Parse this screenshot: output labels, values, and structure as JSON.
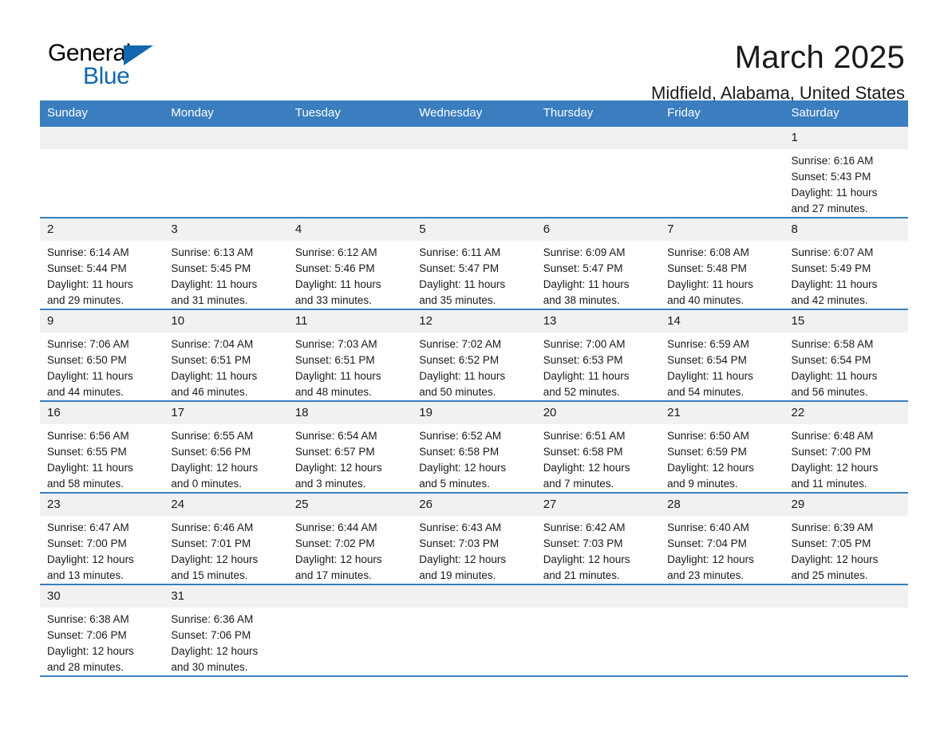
{
  "brand": {
    "name_top": "General",
    "name_bottom": "Blue",
    "accent_color": "#1267b0",
    "flag_icon": "triangle-flag-icon"
  },
  "header": {
    "title": "March 2025",
    "location": "Midfield, Alabama, United States"
  },
  "calendar": {
    "header_bg": "#3a7ebf",
    "row_rule_color": "#3a7ebf",
    "daynum_bg": "#f1f1f1",
    "weekdays": [
      "Sunday",
      "Monday",
      "Tuesday",
      "Wednesday",
      "Thursday",
      "Friday",
      "Saturday"
    ],
    "weeks": [
      [
        {
          "day": "",
          "sunrise": "",
          "sunset": "",
          "daylight_1": "",
          "daylight_2": "",
          "empty": true
        },
        {
          "day": "",
          "sunrise": "",
          "sunset": "",
          "daylight_1": "",
          "daylight_2": "",
          "empty": true
        },
        {
          "day": "",
          "sunrise": "",
          "sunset": "",
          "daylight_1": "",
          "daylight_2": "",
          "empty": true
        },
        {
          "day": "",
          "sunrise": "",
          "sunset": "",
          "daylight_1": "",
          "daylight_2": "",
          "empty": true
        },
        {
          "day": "",
          "sunrise": "",
          "sunset": "",
          "daylight_1": "",
          "daylight_2": "",
          "empty": true
        },
        {
          "day": "",
          "sunrise": "",
          "sunset": "",
          "daylight_1": "",
          "daylight_2": "",
          "empty": true
        },
        {
          "day": "1",
          "sunrise": "Sunrise: 6:16 AM",
          "sunset": "Sunset: 5:43 PM",
          "daylight_1": "Daylight: 11 hours",
          "daylight_2": "and 27 minutes.",
          "empty": false
        }
      ],
      [
        {
          "day": "2",
          "sunrise": "Sunrise: 6:14 AM",
          "sunset": "Sunset: 5:44 PM",
          "daylight_1": "Daylight: 11 hours",
          "daylight_2": "and 29 minutes.",
          "empty": false
        },
        {
          "day": "3",
          "sunrise": "Sunrise: 6:13 AM",
          "sunset": "Sunset: 5:45 PM",
          "daylight_1": "Daylight: 11 hours",
          "daylight_2": "and 31 minutes.",
          "empty": false
        },
        {
          "day": "4",
          "sunrise": "Sunrise: 6:12 AM",
          "sunset": "Sunset: 5:46 PM",
          "daylight_1": "Daylight: 11 hours",
          "daylight_2": "and 33 minutes.",
          "empty": false
        },
        {
          "day": "5",
          "sunrise": "Sunrise: 6:11 AM",
          "sunset": "Sunset: 5:47 PM",
          "daylight_1": "Daylight: 11 hours",
          "daylight_2": "and 35 minutes.",
          "empty": false
        },
        {
          "day": "6",
          "sunrise": "Sunrise: 6:09 AM",
          "sunset": "Sunset: 5:47 PM",
          "daylight_1": "Daylight: 11 hours",
          "daylight_2": "and 38 minutes.",
          "empty": false
        },
        {
          "day": "7",
          "sunrise": "Sunrise: 6:08 AM",
          "sunset": "Sunset: 5:48 PM",
          "daylight_1": "Daylight: 11 hours",
          "daylight_2": "and 40 minutes.",
          "empty": false
        },
        {
          "day": "8",
          "sunrise": "Sunrise: 6:07 AM",
          "sunset": "Sunset: 5:49 PM",
          "daylight_1": "Daylight: 11 hours",
          "daylight_2": "and 42 minutes.",
          "empty": false
        }
      ],
      [
        {
          "day": "9",
          "sunrise": "Sunrise: 7:06 AM",
          "sunset": "Sunset: 6:50 PM",
          "daylight_1": "Daylight: 11 hours",
          "daylight_2": "and 44 minutes.",
          "empty": false
        },
        {
          "day": "10",
          "sunrise": "Sunrise: 7:04 AM",
          "sunset": "Sunset: 6:51 PM",
          "daylight_1": "Daylight: 11 hours",
          "daylight_2": "and 46 minutes.",
          "empty": false
        },
        {
          "day": "11",
          "sunrise": "Sunrise: 7:03 AM",
          "sunset": "Sunset: 6:51 PM",
          "daylight_1": "Daylight: 11 hours",
          "daylight_2": "and 48 minutes.",
          "empty": false
        },
        {
          "day": "12",
          "sunrise": "Sunrise: 7:02 AM",
          "sunset": "Sunset: 6:52 PM",
          "daylight_1": "Daylight: 11 hours",
          "daylight_2": "and 50 minutes.",
          "empty": false
        },
        {
          "day": "13",
          "sunrise": "Sunrise: 7:00 AM",
          "sunset": "Sunset: 6:53 PM",
          "daylight_1": "Daylight: 11 hours",
          "daylight_2": "and 52 minutes.",
          "empty": false
        },
        {
          "day": "14",
          "sunrise": "Sunrise: 6:59 AM",
          "sunset": "Sunset: 6:54 PM",
          "daylight_1": "Daylight: 11 hours",
          "daylight_2": "and 54 minutes.",
          "empty": false
        },
        {
          "day": "15",
          "sunrise": "Sunrise: 6:58 AM",
          "sunset": "Sunset: 6:54 PM",
          "daylight_1": "Daylight: 11 hours",
          "daylight_2": "and 56 minutes.",
          "empty": false
        }
      ],
      [
        {
          "day": "16",
          "sunrise": "Sunrise: 6:56 AM",
          "sunset": "Sunset: 6:55 PM",
          "daylight_1": "Daylight: 11 hours",
          "daylight_2": "and 58 minutes.",
          "empty": false
        },
        {
          "day": "17",
          "sunrise": "Sunrise: 6:55 AM",
          "sunset": "Sunset: 6:56 PM",
          "daylight_1": "Daylight: 12 hours",
          "daylight_2": "and 0 minutes.",
          "empty": false
        },
        {
          "day": "18",
          "sunrise": "Sunrise: 6:54 AM",
          "sunset": "Sunset: 6:57 PM",
          "daylight_1": "Daylight: 12 hours",
          "daylight_2": "and 3 minutes.",
          "empty": false
        },
        {
          "day": "19",
          "sunrise": "Sunrise: 6:52 AM",
          "sunset": "Sunset: 6:58 PM",
          "daylight_1": "Daylight: 12 hours",
          "daylight_2": "and 5 minutes.",
          "empty": false
        },
        {
          "day": "20",
          "sunrise": "Sunrise: 6:51 AM",
          "sunset": "Sunset: 6:58 PM",
          "daylight_1": "Daylight: 12 hours",
          "daylight_2": "and 7 minutes.",
          "empty": false
        },
        {
          "day": "21",
          "sunrise": "Sunrise: 6:50 AM",
          "sunset": "Sunset: 6:59 PM",
          "daylight_1": "Daylight: 12 hours",
          "daylight_2": "and 9 minutes.",
          "empty": false
        },
        {
          "day": "22",
          "sunrise": "Sunrise: 6:48 AM",
          "sunset": "Sunset: 7:00 PM",
          "daylight_1": "Daylight: 12 hours",
          "daylight_2": "and 11 minutes.",
          "empty": false
        }
      ],
      [
        {
          "day": "23",
          "sunrise": "Sunrise: 6:47 AM",
          "sunset": "Sunset: 7:00 PM",
          "daylight_1": "Daylight: 12 hours",
          "daylight_2": "and 13 minutes.",
          "empty": false
        },
        {
          "day": "24",
          "sunrise": "Sunrise: 6:46 AM",
          "sunset": "Sunset: 7:01 PM",
          "daylight_1": "Daylight: 12 hours",
          "daylight_2": "and 15 minutes.",
          "empty": false
        },
        {
          "day": "25",
          "sunrise": "Sunrise: 6:44 AM",
          "sunset": "Sunset: 7:02 PM",
          "daylight_1": "Daylight: 12 hours",
          "daylight_2": "and 17 minutes.",
          "empty": false
        },
        {
          "day": "26",
          "sunrise": "Sunrise: 6:43 AM",
          "sunset": "Sunset: 7:03 PM",
          "daylight_1": "Daylight: 12 hours",
          "daylight_2": "and 19 minutes.",
          "empty": false
        },
        {
          "day": "27",
          "sunrise": "Sunrise: 6:42 AM",
          "sunset": "Sunset: 7:03 PM",
          "daylight_1": "Daylight: 12 hours",
          "daylight_2": "and 21 minutes.",
          "empty": false
        },
        {
          "day": "28",
          "sunrise": "Sunrise: 6:40 AM",
          "sunset": "Sunset: 7:04 PM",
          "daylight_1": "Daylight: 12 hours",
          "daylight_2": "and 23 minutes.",
          "empty": false
        },
        {
          "day": "29",
          "sunrise": "Sunrise: 6:39 AM",
          "sunset": "Sunset: 7:05 PM",
          "daylight_1": "Daylight: 12 hours",
          "daylight_2": "and 25 minutes.",
          "empty": false
        }
      ],
      [
        {
          "day": "30",
          "sunrise": "Sunrise: 6:38 AM",
          "sunset": "Sunset: 7:06 PM",
          "daylight_1": "Daylight: 12 hours",
          "daylight_2": "and 28 minutes.",
          "empty": false
        },
        {
          "day": "31",
          "sunrise": "Sunrise: 6:36 AM",
          "sunset": "Sunset: 7:06 PM",
          "daylight_1": "Daylight: 12 hours",
          "daylight_2": "and 30 minutes.",
          "empty": false
        },
        {
          "day": "",
          "sunrise": "",
          "sunset": "",
          "daylight_1": "",
          "daylight_2": "",
          "empty": true
        },
        {
          "day": "",
          "sunrise": "",
          "sunset": "",
          "daylight_1": "",
          "daylight_2": "",
          "empty": true
        },
        {
          "day": "",
          "sunrise": "",
          "sunset": "",
          "daylight_1": "",
          "daylight_2": "",
          "empty": true
        },
        {
          "day": "",
          "sunrise": "",
          "sunset": "",
          "daylight_1": "",
          "daylight_2": "",
          "empty": true
        },
        {
          "day": "",
          "sunrise": "",
          "sunset": "",
          "daylight_1": "",
          "daylight_2": "",
          "empty": true
        }
      ]
    ]
  }
}
